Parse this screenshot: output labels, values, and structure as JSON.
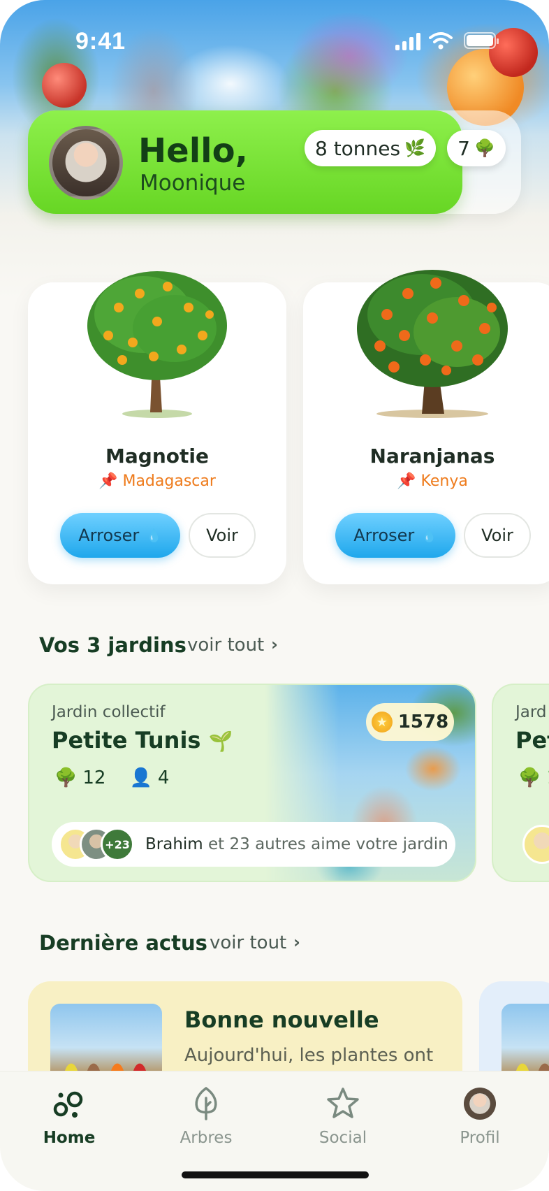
{
  "status_bar": {
    "time": "9:41"
  },
  "header": {
    "greeting": "Hello,",
    "username": "Moonique",
    "tonnes_label": "8 tonnes",
    "trees_count": "7",
    "accent_color": "#67d624"
  },
  "trees": [
    {
      "name": "Magnotie",
      "location": "Madagascar",
      "water_label": "Arroser",
      "view_label": "Voir",
      "fruit_color": "#f2a81d"
    },
    {
      "name": "Naranjanas",
      "location": "Kenya",
      "water_label": "Arroser",
      "view_label": "Voir",
      "fruit_color": "#ef6a1a"
    }
  ],
  "gardens_section": {
    "title": "Vos 3 jardins",
    "see_all": "voir tout"
  },
  "garden": {
    "kind": "Jardin collectif",
    "name": "Petite Tunis",
    "trees": "12",
    "members": "4",
    "score": "1578",
    "avatar_more": "+23",
    "liker": "Brahim",
    "likes_text": "et 23 autres aime votre jardin"
  },
  "garden_peek": {
    "kind": "Jard",
    "name": "Pet",
    "trees": "1"
  },
  "news_section": {
    "title": "Dernière actus",
    "see_all": "voir tout"
  },
  "news": {
    "title": "Bonne nouvelle",
    "body": "Aujourd'hui, les plantes ont"
  },
  "tabs": [
    {
      "label": "Home",
      "icon": "garden-dots-icon",
      "active": true
    },
    {
      "label": "Arbres",
      "icon": "tree-outline-icon",
      "active": false
    },
    {
      "label": "Social",
      "icon": "star-outline-icon",
      "active": false
    },
    {
      "label": "Profil",
      "icon": "avatar-icon",
      "active": false
    }
  ]
}
